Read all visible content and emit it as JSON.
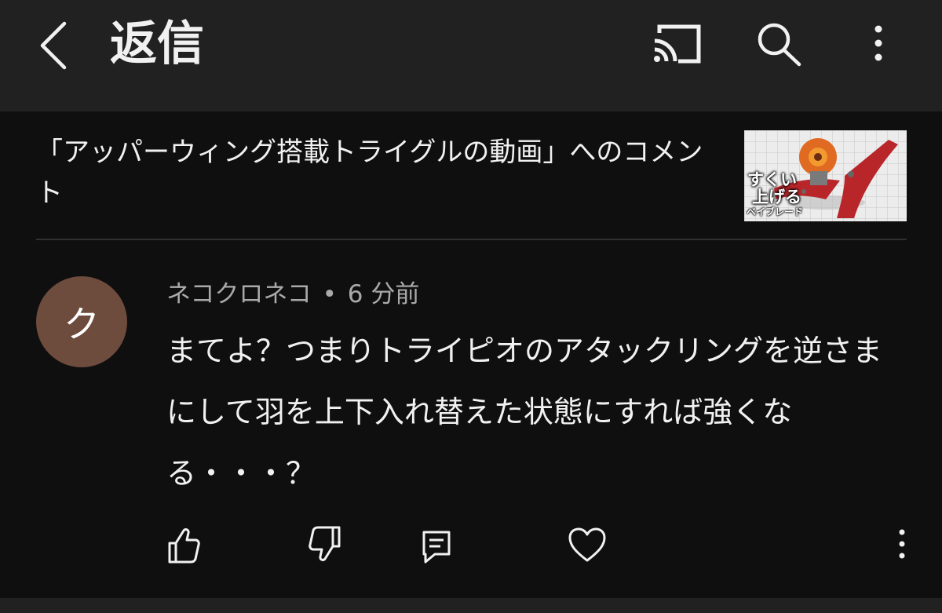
{
  "header": {
    "title": "返信",
    "icons": [
      "chevron-left-icon",
      "cast-icon",
      "search-icon",
      "more-vertical-icon"
    ]
  },
  "video": {
    "context_text": "「アッパーウィング搭載トライグルの動画」へのコメント",
    "thumbnail_caption_line1": "すくい",
    "thumbnail_caption_line2": "上げる",
    "thumbnail_caption_line3": "ベイブレード"
  },
  "comment": {
    "avatar_letter": "ク",
    "author": "ネコクロネコ",
    "separator": "•",
    "time": "6 分前",
    "text": "まてよ？つまりトライピオのアタックリングを逆さまにして羽を上下入れ替えた状態にすれば強くなる・・・？",
    "actions": [
      "thumbs-up-icon",
      "thumbs-down-icon",
      "reply-icon",
      "heart-icon",
      "more-vertical-icon"
    ]
  },
  "colors": {
    "background": "#0f0f0f",
    "header_bg": "#212121",
    "avatar_bg": "#6d4b3d",
    "meta_text": "#aaaaaa"
  }
}
